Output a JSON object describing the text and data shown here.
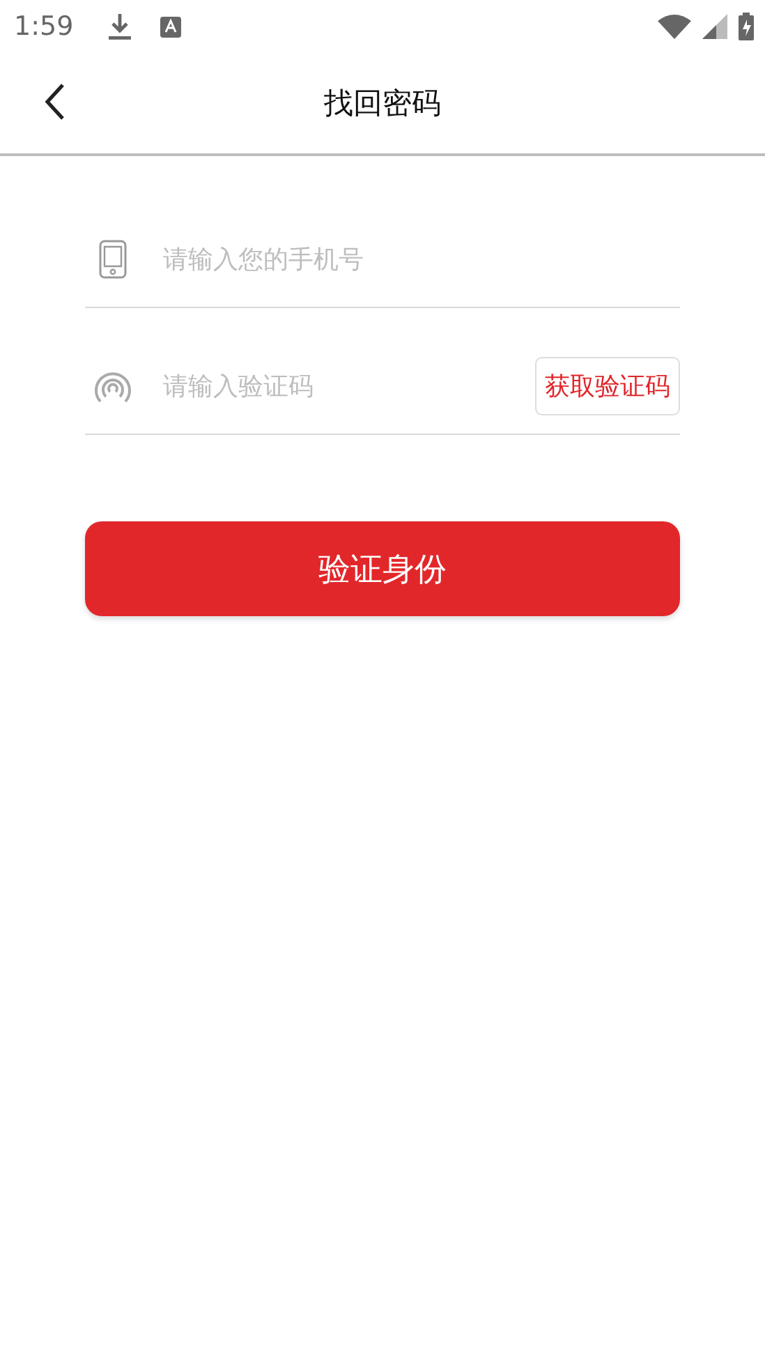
{
  "status_bar": {
    "time": "1:59"
  },
  "header": {
    "title": "找回密码"
  },
  "fields": [
    {
      "kind": "phone",
      "placeholder": "请输入您的手机号"
    },
    {
      "kind": "code",
      "placeholder": "请输入验证码",
      "action": "获取验证码"
    }
  ],
  "submit": {
    "label": "验证身份"
  }
}
